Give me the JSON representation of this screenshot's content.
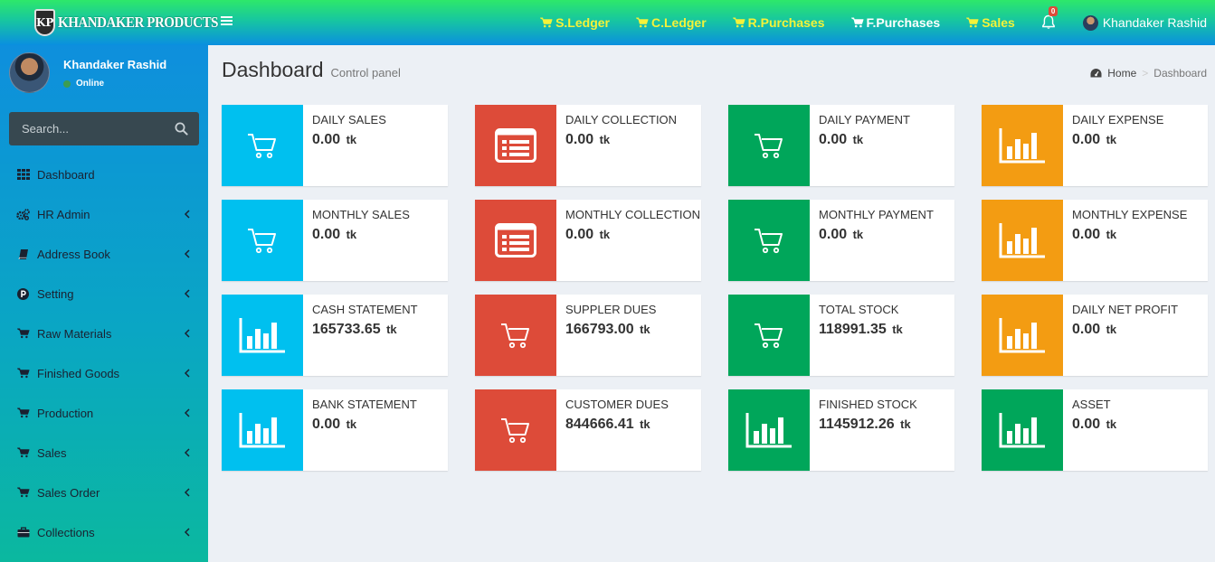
{
  "brand": {
    "badge": "KP",
    "name": "KHANDAKER PRODUCTS"
  },
  "top_nav": [
    {
      "label": "S.Ledger",
      "color": "#f4f23a"
    },
    {
      "label": "C.Ledger",
      "color": "#f4f23a"
    },
    {
      "label": "R.Purchases",
      "color": "#f4f23a"
    },
    {
      "label": "F.Purchases",
      "color": "#ffffff"
    },
    {
      "label": "Sales",
      "color": "#f4f23a"
    }
  ],
  "notifications": {
    "count": "0"
  },
  "user": {
    "name": "Khandaker Rashid",
    "status": "Online"
  },
  "search": {
    "placeholder": "Search..."
  },
  "sidebar": {
    "items": [
      {
        "label": "Dashboard",
        "icon": "grid-icon",
        "has_children": false
      },
      {
        "label": "HR Admin",
        "icon": "gears-icon",
        "has_children": true
      },
      {
        "label": "Address Book",
        "icon": "book-icon",
        "has_children": true
      },
      {
        "label": "Setting",
        "icon": "parking-icon",
        "has_children": true
      },
      {
        "label": "Raw Materials",
        "icon": "cart-icon",
        "has_children": true
      },
      {
        "label": "Finished Goods",
        "icon": "cart-icon",
        "has_children": true
      },
      {
        "label": "Production",
        "icon": "cart-icon",
        "has_children": true
      },
      {
        "label": "Sales",
        "icon": "cart-icon",
        "has_children": true
      },
      {
        "label": "Sales Order",
        "icon": "cart-icon",
        "has_children": true
      },
      {
        "label": "Collections",
        "icon": "briefcase-icon",
        "has_children": true
      }
    ]
  },
  "page": {
    "title": "Dashboard",
    "subtitle": "Control panel"
  },
  "breadcrumb": {
    "home": "Home",
    "current": "Dashboard"
  },
  "unit": "tk",
  "colors": {
    "aqua": "#00c0ef",
    "red": "#dd4b39",
    "green": "#00a65a",
    "yellow": "#f39c12"
  },
  "boxes": [
    {
      "label": "DAILY SALES",
      "value": "0.00",
      "color": "aqua",
      "icon": "cart-icon"
    },
    {
      "label": "DAILY COLLECTION",
      "value": "0.00",
      "color": "red",
      "icon": "list-alt-icon"
    },
    {
      "label": "DAILY PAYMENT",
      "value": "0.00",
      "color": "green",
      "icon": "cart-icon"
    },
    {
      "label": "DAILY EXPENSE",
      "value": "0.00",
      "color": "yellow",
      "icon": "bar-chart-icon"
    },
    {
      "label": "MONTHLY SALES",
      "value": "0.00",
      "color": "aqua",
      "icon": "cart-icon"
    },
    {
      "label": "MONTHLY COLLECTION",
      "value": "0.00",
      "color": "red",
      "icon": "list-alt-icon"
    },
    {
      "label": "MONTHLY PAYMENT",
      "value": "0.00",
      "color": "green",
      "icon": "cart-icon"
    },
    {
      "label": "MONTHLY EXPENSE",
      "value": "0.00",
      "color": "yellow",
      "icon": "bar-chart-icon"
    },
    {
      "label": "CASH STATEMENT",
      "value": "165733.65",
      "color": "aqua",
      "icon": "bar-chart-icon"
    },
    {
      "label": "SUPPLER DUES",
      "value": "166793.00",
      "color": "red",
      "icon": "cart-icon"
    },
    {
      "label": "TOTAL STOCK",
      "value": "118991.35",
      "color": "green",
      "icon": "cart-icon"
    },
    {
      "label": "DAILY NET PROFIT",
      "value": "0.00",
      "color": "yellow",
      "icon": "bar-chart-icon"
    },
    {
      "label": "BANK STATEMENT",
      "value": "0.00",
      "color": "aqua",
      "icon": "bar-chart-icon"
    },
    {
      "label": "CUSTOMER DUES",
      "value": "844666.41",
      "color": "red",
      "icon": "cart-icon"
    },
    {
      "label": "FINISHED STOCK",
      "value": "1145912.26",
      "color": "green",
      "icon": "bar-chart-icon"
    },
    {
      "label": "ASSET",
      "value": "0.00",
      "color": "green",
      "icon": "bar-chart-icon"
    }
  ]
}
